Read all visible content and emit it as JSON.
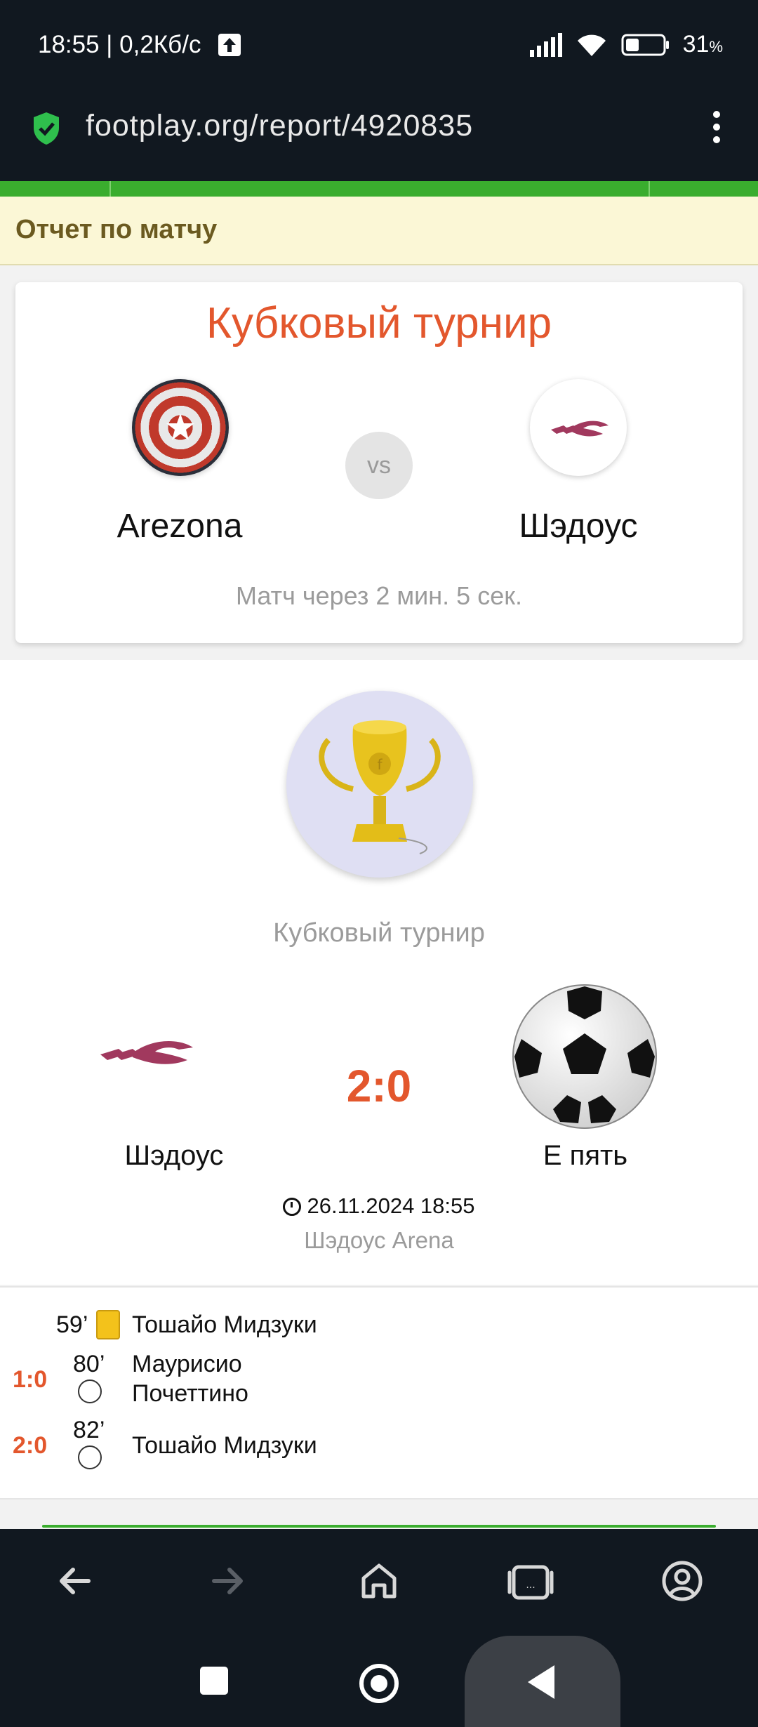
{
  "status_bar": {
    "time": "18:55 | 0,2Кб/с",
    "battery": "31",
    "battery_unit": "%"
  },
  "browser": {
    "url": "footplay.org/report/4920835"
  },
  "page": {
    "header_title": "Отчет по матчу"
  },
  "upcoming_match": {
    "tournament": "Кубковый турнир",
    "vs_label": "vs",
    "home_team": "Arezona",
    "away_team": "Шэдоус",
    "countdown": "Матч через 2 мин. 5 сек."
  },
  "result": {
    "tournament": "Кубковый турнир",
    "home_team": "Шэдоус",
    "away_team": "Е пять",
    "score": "2:0",
    "datetime": "26.11.2024 18:55",
    "venue": "Шэдоус Arena"
  },
  "events": [
    {
      "score": "",
      "minute": "59’",
      "type": "yellow-card",
      "player": "Тошайо Мидзуки"
    },
    {
      "score": "1:0",
      "minute": "80’",
      "type": "goal",
      "player": "Маурисио Почеттино"
    },
    {
      "score": "2:0",
      "minute": "82’",
      "type": "goal",
      "player": "Тошайо Мидзуки"
    }
  ],
  "colors": {
    "accent": "#e3572d",
    "green": "#3aad2e",
    "dark_bar": "#111820"
  },
  "icons": {
    "toolbar": [
      "back-arrow-icon",
      "forward-arrow-icon",
      "home-icon",
      "tabs-icon",
      "account-icon"
    ],
    "nav": [
      "recents-square-icon",
      "home-circle-icon",
      "back-triangle-icon"
    ]
  }
}
